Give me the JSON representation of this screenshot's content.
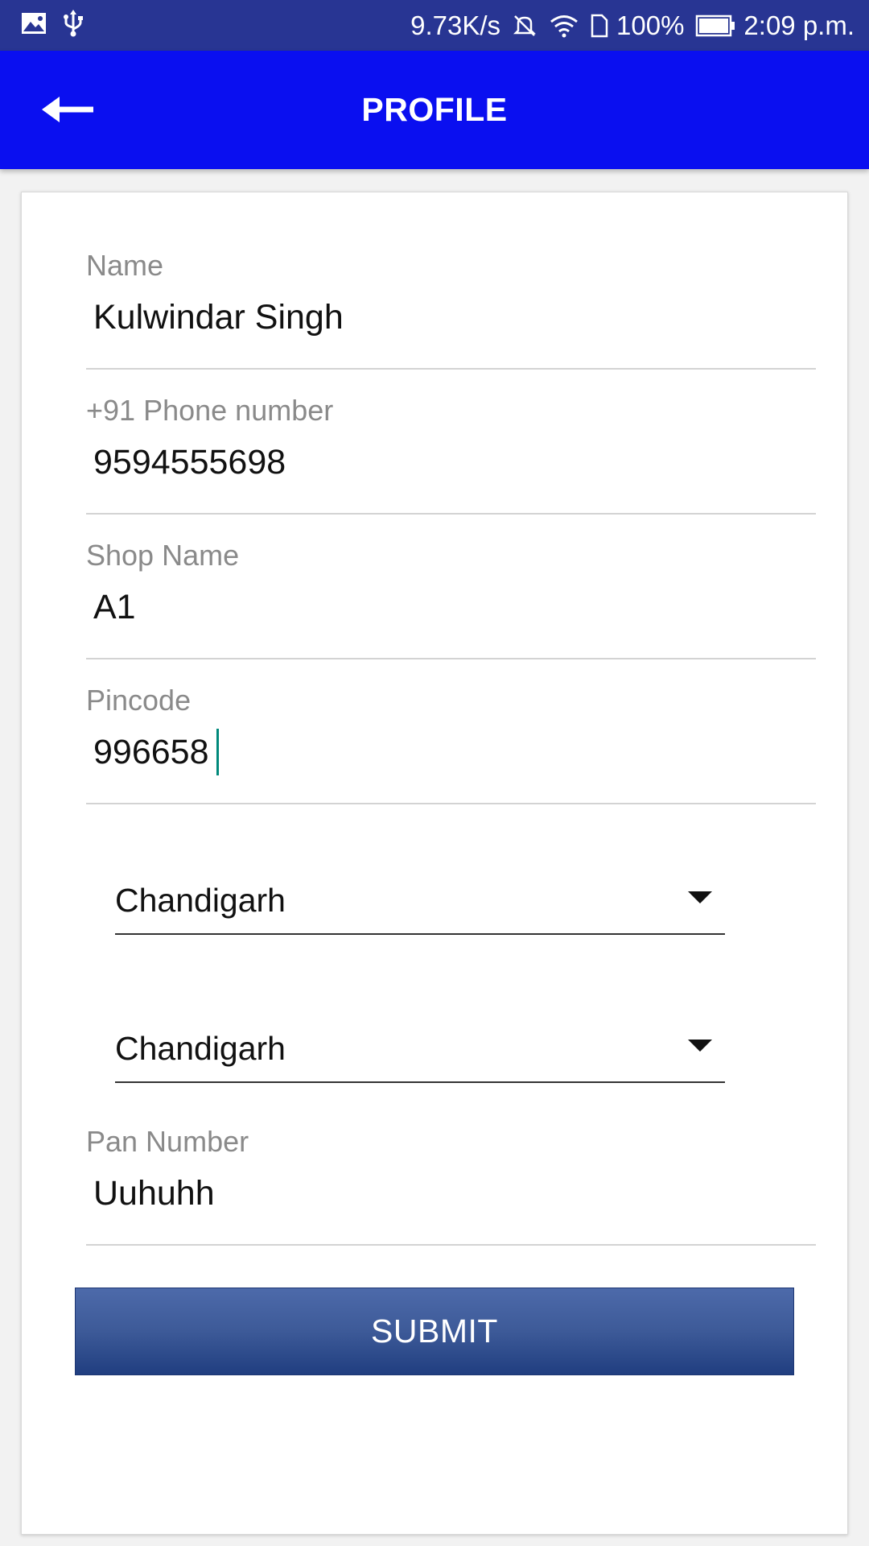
{
  "status_bar": {
    "left_icons": [
      "image-icon",
      "usb-icon"
    ],
    "network_speed": "9.73K/s",
    "battery_percent": "100%",
    "time": "2:09 p.m.",
    "right_icons": [
      "mute-icon",
      "wifi-icon",
      "sim-icon",
      "battery-icon"
    ]
  },
  "app_bar": {
    "title": "PROFILE",
    "back_icon": "back-arrow-icon",
    "color": "#0a0ff0"
  },
  "form": {
    "name": {
      "label": "Name",
      "value": "Kulwindar Singh"
    },
    "phone": {
      "label": "+91 Phone number",
      "value": "9594555698"
    },
    "shop_name": {
      "label": "Shop Name",
      "value": "A1"
    },
    "pincode": {
      "label": "Pincode",
      "value": "996658"
    },
    "state": {
      "selected": "Chandigarh"
    },
    "city": {
      "selected": "Chandigarh"
    },
    "pan": {
      "label": "Pan Number",
      "value": "Uuhuhh"
    },
    "submit_label": "SUBMIT"
  },
  "colors": {
    "status_bar": "#283593",
    "app_bar": "#0a0ff0",
    "submit_button": "#3d5a98",
    "cursor": "#00897b"
  }
}
